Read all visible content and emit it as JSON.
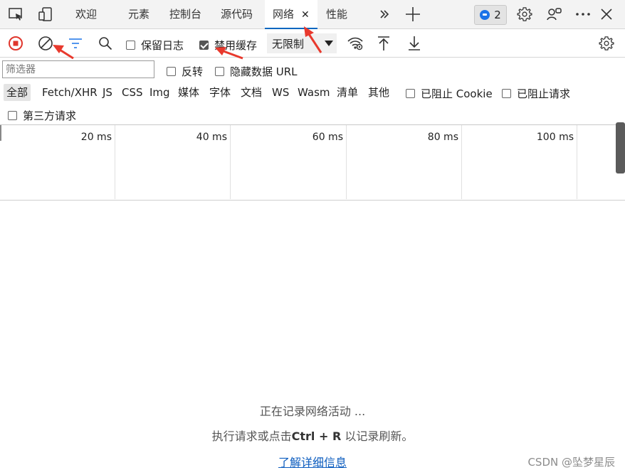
{
  "tabs": [
    {
      "label": "欢迎"
    },
    {
      "label": "元素"
    },
    {
      "label": "控制台"
    },
    {
      "label": "源代码"
    },
    {
      "label": "网络",
      "close": "✕"
    },
    {
      "label": "性能"
    }
  ],
  "tabbar": {
    "issues_count": "2"
  },
  "toolbar": {
    "preserve_log": "保留日志",
    "disable_cache": "禁用缓存",
    "throttle_value": "无限制"
  },
  "filter": {
    "placeholder": "筛选器",
    "invert": "反转",
    "hide_data_urls": "隐藏数据 URL",
    "types": [
      "全部",
      "Fetch/XHR",
      "JS",
      "CSS",
      "Img",
      "媒体",
      "字体",
      "文档",
      "WS",
      "Wasm",
      "清单",
      "其他"
    ],
    "blocked_cookies": "已阻止 Cookie",
    "blocked_requests": "已阻止请求",
    "third_party": "第三方请求"
  },
  "timeline": {
    "ticks": [
      "20 ms",
      "40 ms",
      "60 ms",
      "80 ms",
      "100 ms"
    ]
  },
  "empty_state": {
    "line1": "正在记录网络活动 ...",
    "line2_prefix": "执行请求或点击",
    "line2_shortcut": "Ctrl + R",
    "line2_suffix": "以记录刷新。",
    "learn_more": "了解详细信息"
  },
  "watermark": "CSDN @坠梦星辰",
  "colors": {
    "record": "#e0362c",
    "accent": "#0067c0",
    "annotation_arrow": "#e8392d"
  }
}
